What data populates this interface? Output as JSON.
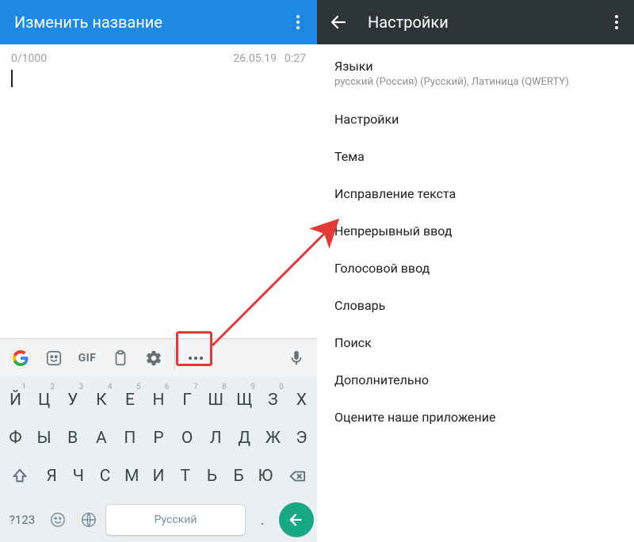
{
  "left": {
    "header": {
      "title": "Изменить название"
    },
    "counter": "0/1000",
    "date": "26.05.19",
    "time": "0:27",
    "keyboard": {
      "gif_label": "GIF",
      "rows": [
        [
          {
            "ch": "Й",
            "hint": "1"
          },
          {
            "ch": "Ц",
            "hint": "2"
          },
          {
            "ch": "У",
            "hint": "3"
          },
          {
            "ch": "К",
            "hint": "4"
          },
          {
            "ch": "Е",
            "hint": "5"
          },
          {
            "ch": "Н",
            "hint": "6"
          },
          {
            "ch": "Г",
            "hint": "7"
          },
          {
            "ch": "Ш",
            "hint": "8"
          },
          {
            "ch": "Щ",
            "hint": "9"
          },
          {
            "ch": "З",
            "hint": "0"
          },
          {
            "ch": "Х",
            "hint": ""
          }
        ],
        [
          {
            "ch": "Ф"
          },
          {
            "ch": "Ы"
          },
          {
            "ch": "В"
          },
          {
            "ch": "А"
          },
          {
            "ch": "П"
          },
          {
            "ch": "Р"
          },
          {
            "ch": "О"
          },
          {
            "ch": "Л"
          },
          {
            "ch": "Д"
          },
          {
            "ch": "Ж"
          },
          {
            "ch": "Э"
          }
        ],
        [
          {
            "ch": "Я"
          },
          {
            "ch": "Ч"
          },
          {
            "ch": "С"
          },
          {
            "ch": "М"
          },
          {
            "ch": "И"
          },
          {
            "ch": "Т"
          },
          {
            "ch": "Ь"
          },
          {
            "ch": "Б"
          },
          {
            "ch": "Ю"
          }
        ]
      ],
      "sym_label": "?123",
      "space_label": "Русский",
      "period_label": "."
    }
  },
  "right": {
    "header": {
      "title": "Настройки"
    },
    "items": [
      {
        "primary": "Языки",
        "secondary": "русский (Россия) (Русский), Латиница (QWERTY)"
      },
      {
        "primary": "Настройки"
      },
      {
        "primary": "Тема"
      },
      {
        "primary": "Исправление текста"
      },
      {
        "primary": "Непрерывный ввод"
      },
      {
        "primary": "Голосовой ввод"
      },
      {
        "primary": "Словарь"
      },
      {
        "primary": "Поиск"
      },
      {
        "primary": "Дополнительно"
      },
      {
        "primary": "Оцените наше приложение"
      }
    ]
  }
}
